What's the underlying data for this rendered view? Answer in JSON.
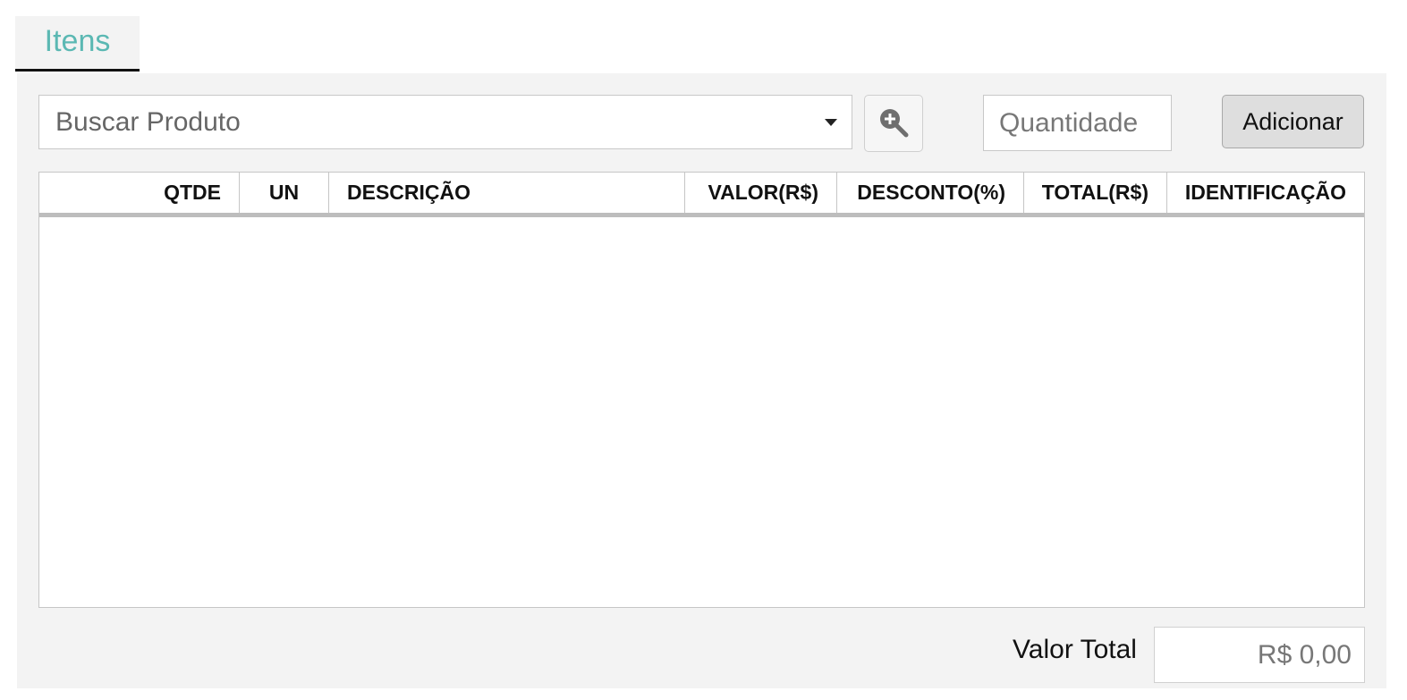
{
  "tab": {
    "label": "Itens",
    "accent": "#5bb8b3"
  },
  "toolbar": {
    "product_search_placeholder": "Buscar Produto",
    "search_icon": "zoom-in-icon",
    "quantity_placeholder": "Quantidade",
    "add_label": "Adicionar"
  },
  "grid": {
    "columns": [
      "QTDE",
      "UN",
      "DESCRIÇÃO",
      "VALOR(R$)",
      "DESCONTO(%)",
      "TOTAL(R$)",
      "IDENTIFICAÇÃO"
    ],
    "rows": []
  },
  "footer": {
    "total_label": "Valor Total",
    "total_value": "R$ 0,00"
  }
}
